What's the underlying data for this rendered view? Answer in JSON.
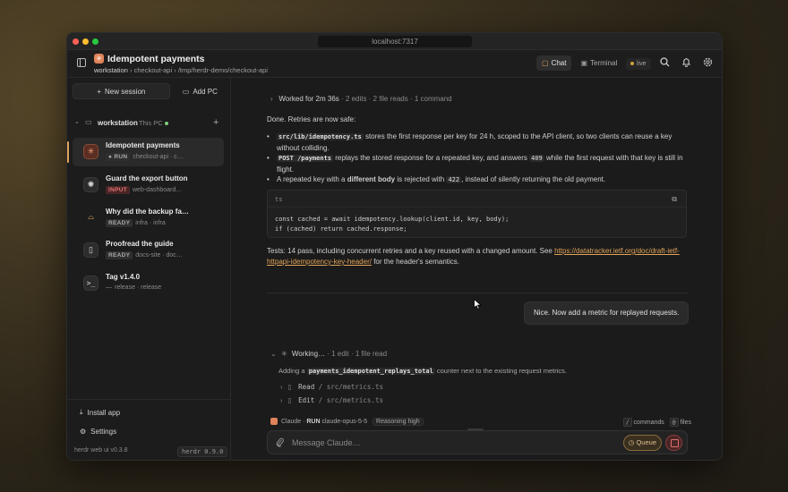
{
  "browser": {
    "url": "localhost:7317"
  },
  "header": {
    "title": "Idempotent payments",
    "breadcrumb": {
      "host": "workstation",
      "repo": "checkout-api",
      "path": "/tmp/herdr-demo/checkout-api"
    },
    "tabs": [
      {
        "label": "Chat",
        "active": true
      },
      {
        "label": "Terminal",
        "active": false
      }
    ],
    "live_label": "live"
  },
  "sidebar": {
    "new_session_label": "New session",
    "add_pc_label": "Add PC",
    "workspace": {
      "name": "workstation",
      "sub": "This PC"
    },
    "sessions": [
      {
        "name": "Idempotent payments",
        "status": "RUN",
        "meta": "checkout-api · c…",
        "icon": "claude-icon",
        "active": true
      },
      {
        "name": "Guard the export button",
        "status": "INPUT",
        "meta": "web-dashboard…",
        "icon": "openai-icon",
        "active": false
      },
      {
        "name": "Why did the backup fa…",
        "status": "READY",
        "meta": "infra · infra",
        "icon": "opencode-icon",
        "active": false
      },
      {
        "name": "Proofread the guide",
        "status": "READY",
        "meta": "docs-site · doc…",
        "icon": "document-icon",
        "active": false
      },
      {
        "name": "Tag v1.4.0",
        "status": "—",
        "meta": "release · release",
        "icon": "terminal-icon",
        "active": false
      }
    ],
    "install_app_label": "Install app",
    "settings_label": "Settings",
    "web_version": "herdr web ui v0.3.8",
    "cli_version": "herdr 0.9.0"
  },
  "chat": {
    "worked": {
      "label": "Worked for 2m 36s",
      "summary": "· 2 edits · 2 file reads · 1 command"
    },
    "intro": "Done. Retries are now safe:",
    "bullets": [
      {
        "code": "src/lib/idempotency.ts",
        "text": "stores the first response per key for 24 h, scoped to the API client, so two clients can reuse a key",
        "text2": "without colliding."
      },
      {
        "code": "POST /payments",
        "text_a": "replays the stored response for a repeated key, and answers",
        "code2": "409",
        "text_b": "while the first request with that key is still in",
        "text2": "flight."
      },
      {
        "text_a": "A repeated key with a",
        "bold": "different body",
        "text_b": "is rejected with",
        "code2": "422",
        "text_c": ", instead of silently returning the old payment."
      }
    ],
    "code_block": {
      "lang": "ts",
      "line1": "const cached = await idempotency.lookup(client.id, key, body);",
      "line2": "if (cached) return cached.response;"
    },
    "tests_text": "Tests: 14 pass, including concurrent retries and a key reused with a changed amount. See",
    "tests_link": "https://datatracker.ietf.org/doc/draft-ietf-httpapi-idempotency-key-header/",
    "tests_link_a": "https://datatracker.ietf.org/doc/draft-ietf-",
    "tests_link_b": "httpapi-idempotency-key-header/",
    "tests_tail": "for the header's semantics.",
    "user_message": "Nice. Now add a metric for replayed requests.",
    "working": {
      "label": "Working…",
      "summary": "· 1 edit · 1 file read"
    },
    "working_note_a": "Adding a",
    "working_note_code": "payments_idempotent_replays_total",
    "working_note_b": "counter next to the existing request metrics.",
    "tools": [
      {
        "action": "Read",
        "path": "src/metrics.ts"
      },
      {
        "action": "Edit",
        "path": "src/metrics.ts"
      }
    ]
  },
  "status": {
    "agent": "Claude",
    "state": "RUN",
    "model": "claude-opus-5-5",
    "reasoning": "Reasoning high",
    "commands_key": "/",
    "commands_label": "commands",
    "files_key": "@",
    "files_label": "files"
  },
  "composer": {
    "placeholder": "Message Claude…",
    "queue_label": "Queue"
  },
  "colors": {
    "accent": "#e0a35a",
    "brand": "#e0835a",
    "danger": "#e07070"
  }
}
